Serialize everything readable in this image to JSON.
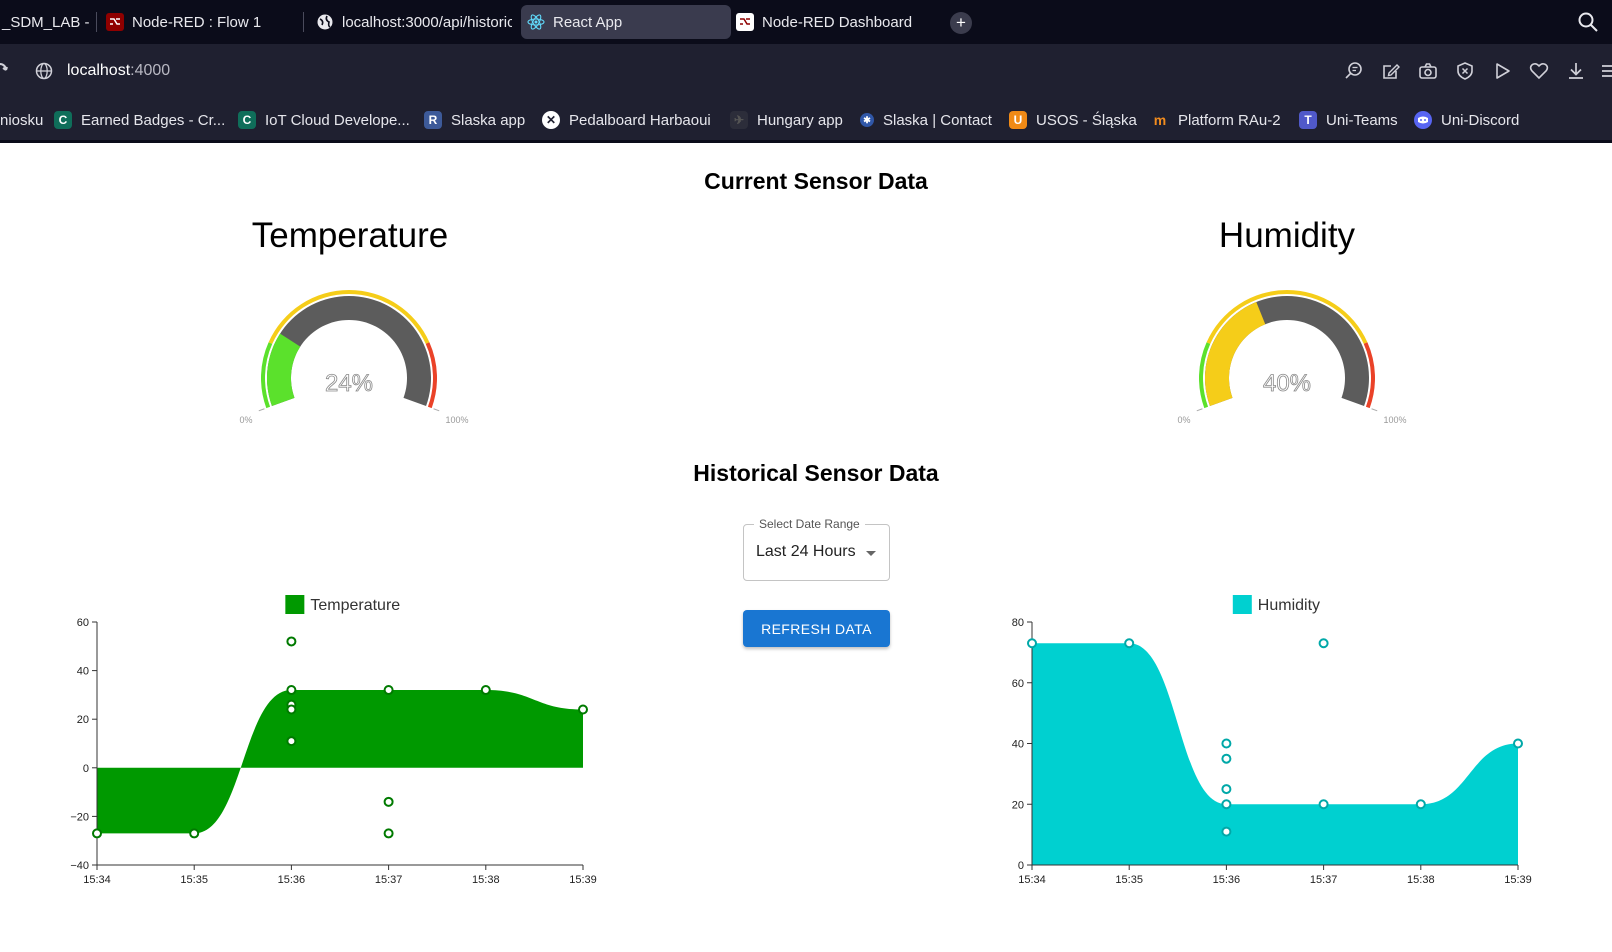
{
  "browser": {
    "tabs": [
      {
        "label": "_SDM_LAB - V",
        "icon": "document-icon",
        "active": false
      },
      {
        "label": "Node-RED : Flow 1",
        "icon": "node-red-icon",
        "active": false
      },
      {
        "label": "localhost:3000/api/historic",
        "icon": "globe-icon",
        "active": false
      },
      {
        "label": "React App",
        "icon": "react-icon",
        "active": true
      },
      {
        "label": "Node-RED Dashboard",
        "icon": "node-red-icon",
        "active": false
      }
    ],
    "new_tab": "+",
    "address": {
      "host": "localhost",
      "port": ":4000"
    },
    "bookmarks": [
      {
        "label": "niosku",
        "icon": "none"
      },
      {
        "label": "Earned Badges - Cr...",
        "icon": "credly-icon",
        "color": "#0f6e5a"
      },
      {
        "label": "IoT Cloud Develope...",
        "icon": "credly-icon",
        "color": "#0f6e5a"
      },
      {
        "label": "Slaska app",
        "icon": "r-icon",
        "color": "#3d5a99"
      },
      {
        "label": "Pedalboard Harbaoui",
        "icon": "x-circle-icon",
        "color": "#ffffff"
      },
      {
        "label": "Hungary app",
        "icon": "plane-icon",
        "color": "#2c2d3a"
      },
      {
        "label": "Slaska | Contact",
        "icon": "emblem-icon",
        "color": "#3057a8"
      },
      {
        "label": "USOS - Śląska",
        "icon": "u-icon",
        "color": "#f08a16"
      },
      {
        "label": "Platform RAu-2",
        "icon": "moodle-icon",
        "color": "#f28c1e"
      },
      {
        "label": "Uni-Teams",
        "icon": "teams-icon",
        "color": "#5059c9"
      },
      {
        "label": "Uni-Discord",
        "icon": "discord-icon",
        "color": "#e4322b"
      }
    ]
  },
  "page": {
    "current_title": "Current Sensor Data",
    "historical_title": "Historical Sensor Data",
    "gauges": [
      {
        "title": "Temperature",
        "value": 24,
        "value_text": "24%",
        "min_label": "0%",
        "max_label": "100%",
        "fill_color": "#5be12c"
      },
      {
        "title": "Humidity",
        "value": 40,
        "value_text": "40%",
        "min_label": "0%",
        "max_label": "100%",
        "fill_color": "#f5cd19"
      }
    ],
    "gauge_bands": [
      {
        "from": 0,
        "to": 0.2,
        "color": "#5be12c"
      },
      {
        "from": 0.2,
        "to": 0.8,
        "color": "#f5cd19"
      },
      {
        "from": 0.8,
        "to": 1,
        "color": "#ea4228"
      }
    ],
    "date_range": {
      "label": "Select Date Range",
      "value": "Last 24 Hours"
    },
    "refresh_label": "REFRESH DATA"
  },
  "chart_data": [
    {
      "type": "area",
      "legend": "Temperature",
      "color": "#009900",
      "x_ticks": [
        "15:34",
        "15:35",
        "15:36",
        "15:37",
        "15:38",
        "15:39"
      ],
      "y_ticks": [
        -40,
        -20,
        0,
        20,
        40,
        60
      ],
      "ylim": [
        -40,
        60
      ],
      "xlim": [
        0,
        5
      ],
      "curve": [
        [
          0,
          -27
        ],
        [
          1,
          -27
        ],
        [
          2,
          32
        ],
        [
          3,
          32
        ],
        [
          4,
          32
        ],
        [
          5,
          24
        ]
      ],
      "points": [
        [
          0,
          -27
        ],
        [
          1,
          -27
        ],
        [
          2,
          52
        ],
        [
          2,
          32
        ],
        [
          2,
          26
        ],
        [
          2,
          24
        ],
        [
          2,
          11
        ],
        [
          3,
          32
        ],
        [
          3,
          -14
        ],
        [
          3,
          -27
        ],
        [
          4,
          32
        ],
        [
          5,
          24
        ]
      ]
    },
    {
      "type": "area",
      "legend": "Humidity",
      "color": "#00d0d0",
      "x_ticks": [
        "15:34",
        "15:35",
        "15:36",
        "15:37",
        "15:38",
        "15:39"
      ],
      "y_ticks": [
        0,
        20,
        40,
        60,
        80
      ],
      "ylim": [
        0,
        80
      ],
      "xlim": [
        0,
        5
      ],
      "curve": [
        [
          0,
          73
        ],
        [
          1,
          73
        ],
        [
          2,
          20
        ],
        [
          3,
          20
        ],
        [
          4,
          20
        ],
        [
          5,
          40
        ]
      ],
      "points": [
        [
          0,
          73
        ],
        [
          1,
          73
        ],
        [
          2,
          40
        ],
        [
          2,
          35
        ],
        [
          2,
          25
        ],
        [
          2,
          20
        ],
        [
          2,
          11
        ],
        [
          3,
          73
        ],
        [
          3,
          20
        ],
        [
          4,
          20
        ],
        [
          5,
          40
        ]
      ]
    }
  ]
}
